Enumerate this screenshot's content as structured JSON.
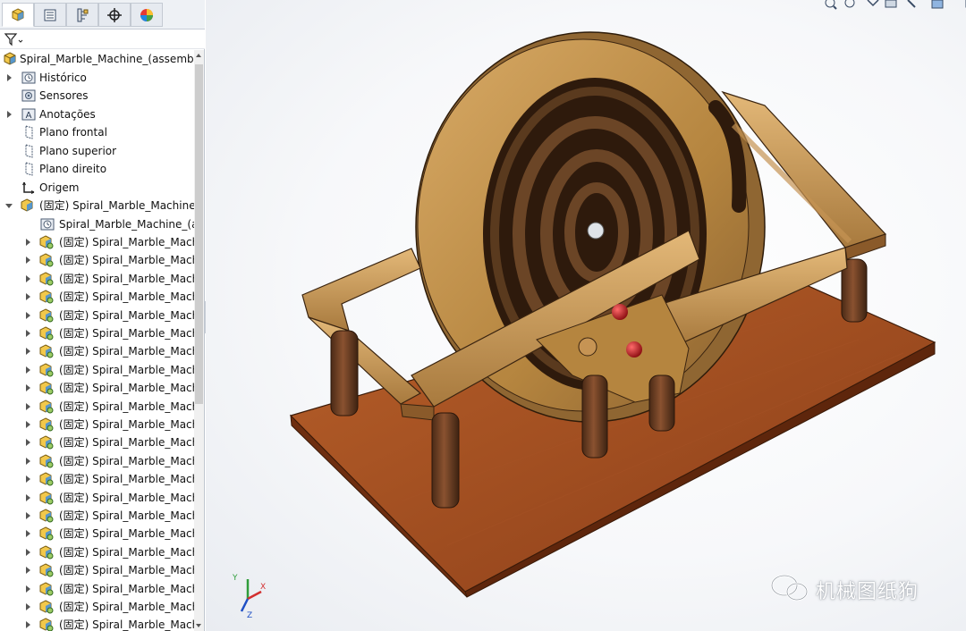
{
  "tabs": [
    {
      "icon": "feature-manager-icon",
      "active": true
    },
    {
      "icon": "property-manager-icon",
      "active": false
    },
    {
      "icon": "configuration-manager-icon",
      "active": false
    },
    {
      "icon": "dimxpert-manager-icon",
      "active": false
    },
    {
      "icon": "display-manager-icon",
      "active": false
    }
  ],
  "filter": {
    "icon": "filter-icon"
  },
  "tree": {
    "root_label": "Spiral_Marble_Machine_(assembly)",
    "items": [
      {
        "label": "Histórico",
        "icon": "history-folder-icon",
        "expander": "collapsed"
      },
      {
        "label": "Sensores",
        "icon": "sensors-icon",
        "expander": "none"
      },
      {
        "label": "Anotações",
        "icon": "annotations-icon",
        "expander": "collapsed"
      },
      {
        "label": "Plano frontal",
        "icon": "plane-icon",
        "expander": "none"
      },
      {
        "label": "Plano superior",
        "icon": "plane-icon",
        "expander": "none"
      },
      {
        "label": "Plano direito",
        "icon": "plane-icon",
        "expander": "none"
      },
      {
        "label": "Origem",
        "icon": "origin-icon",
        "expander": "none"
      }
    ],
    "subassembly_label": "(固定) Spiral_Marble_Machine_(a",
    "subassembly_child_label": "Spiral_Marble_Machine_(ass",
    "part_label": "(固定) Spiral_Marble_Machin",
    "part_count": 22
  },
  "watermark": {
    "text": "机械图纸狗",
    "icon": "wechat-icon"
  },
  "triad": {
    "x_label": "X",
    "y_label": "Y",
    "z_label": "Z"
  },
  "colors": {
    "wood_light": "#c99a5b",
    "wood_dark": "#3b2414",
    "base_wood": "#9a4a1f",
    "leg": "#6e3f22",
    "marble": "#c0141c",
    "accent_blue": "#2b6cc4"
  }
}
